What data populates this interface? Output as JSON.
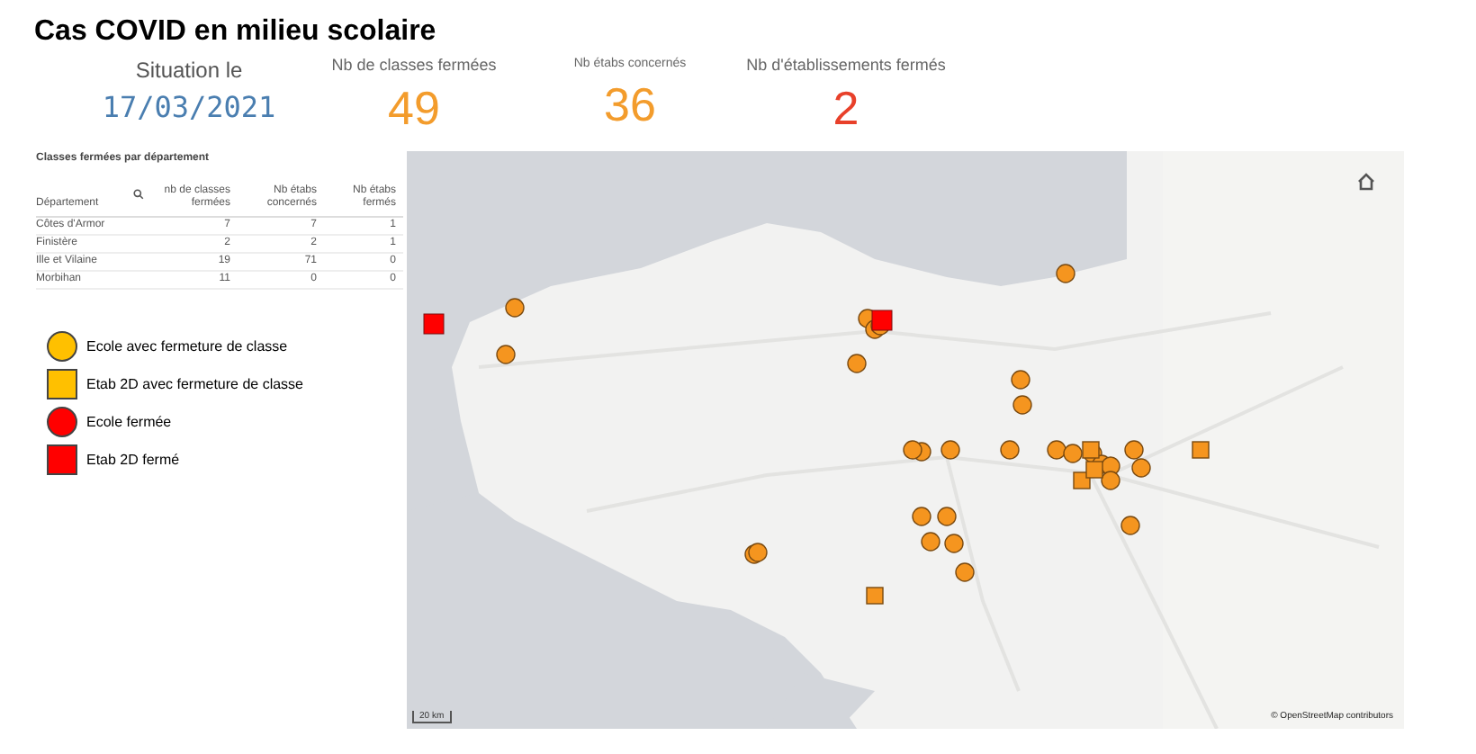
{
  "title": "Cas COVID en milieu scolaire",
  "situation": {
    "label": "Situation le",
    "date": "17/03/2021"
  },
  "kpis": [
    {
      "label": "Nb de classes fermées",
      "value": "49",
      "color": "#f39c2c"
    },
    {
      "label": "Nb étabs concernés",
      "value": "36",
      "color": "#f39c2c"
    },
    {
      "label": "Nb d'établissements fermés",
      "value": "2",
      "color": "#e8402a"
    }
  ],
  "table": {
    "title": "Classes fermées par département",
    "columns": [
      "Département",
      "nb de classes fermées",
      "Nb étabs concernés",
      "Nb étabs fermés"
    ],
    "rows": [
      [
        "Côtes d'Armor",
        "7",
        "7",
        "1"
      ],
      [
        "Finistère",
        "2",
        "2",
        "1"
      ],
      [
        "Ille et Vilaine",
        "19",
        "71",
        "0"
      ],
      [
        "Morbihan",
        "11",
        "0",
        "0"
      ]
    ]
  },
  "legend": [
    {
      "kind": "circle",
      "color": "#ffc000",
      "label": "Ecole avec fermeture de classe"
    },
    {
      "kind": "square",
      "color": "#ffc000",
      "label": "Etab 2D avec fermeture de classe"
    },
    {
      "kind": "circle",
      "color": "#ff0000",
      "label": "Ecole fermée"
    },
    {
      "kind": "square",
      "color": "#ff0000",
      "label": "Etab 2D fermé"
    }
  ],
  "map": {
    "scale": "20 km",
    "attribution": "© OpenStreetMap contributors"
  }
}
